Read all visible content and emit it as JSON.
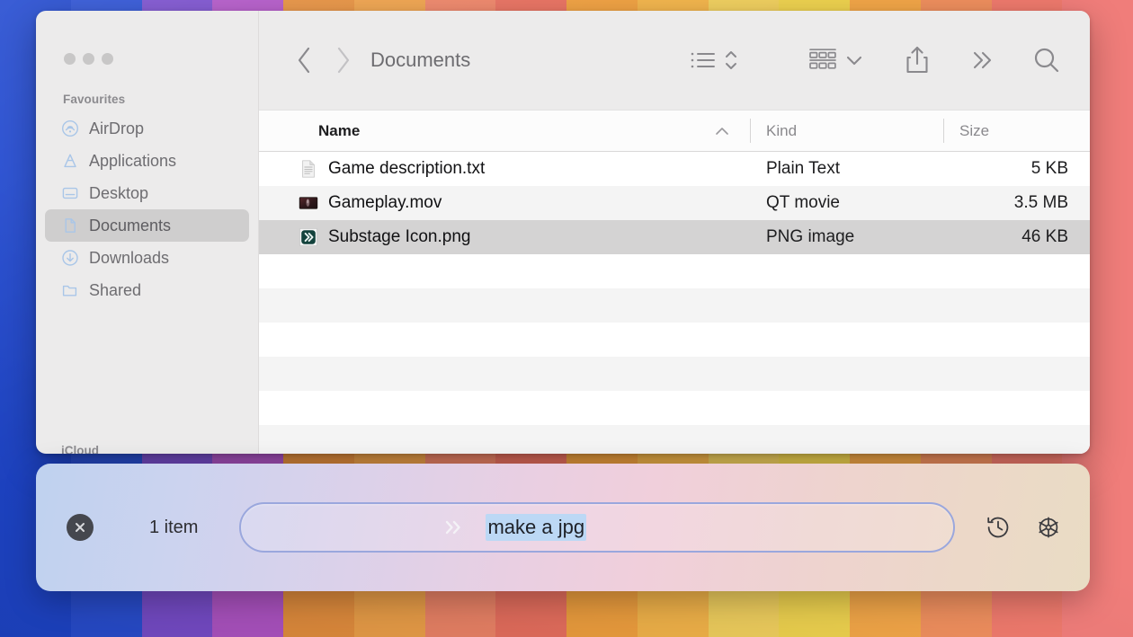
{
  "desktop": {
    "wallpaper_bands": [
      "#1f47cf",
      "#2a50d6",
      "#7b4fd0",
      "#b356c9",
      "#e8913f",
      "#f0a24a",
      "#ef8568",
      "#e9705f",
      "#f0a03f",
      "#f3b44a",
      "#f0cf5e",
      "#eed24f",
      "#f2a648",
      "#ef8f5e",
      "#ef7a6d",
      "#f07d7a"
    ]
  },
  "window": {
    "title": "Documents",
    "traffic_lights": [
      {
        "name": "close-button",
        "color": "#c8c7c7"
      },
      {
        "name": "minimize-button",
        "color": "#c8c7c7"
      },
      {
        "name": "zoom-button",
        "color": "#c8c7c7"
      }
    ]
  },
  "sidebar": {
    "sections": [
      {
        "header": "Favourites",
        "items": [
          {
            "label": "AirDrop",
            "icon": "airdrop-icon",
            "selected": false
          },
          {
            "label": "Applications",
            "icon": "applications-icon",
            "selected": false
          },
          {
            "label": "Desktop",
            "icon": "desktop-icon",
            "selected": false
          },
          {
            "label": "Documents",
            "icon": "document-icon",
            "selected": true
          },
          {
            "label": "Downloads",
            "icon": "downloads-icon",
            "selected": false
          },
          {
            "label": "Shared",
            "icon": "folder-icon",
            "selected": false
          }
        ]
      }
    ],
    "next_header": "iCloud"
  },
  "toolbar": {
    "back": {
      "icon": "chevron-left-icon",
      "enabled": true
    },
    "forward": {
      "icon": "chevron-right-icon",
      "enabled": false
    },
    "path_title": "Documents",
    "view_list": {
      "icon": "list-view-icon"
    },
    "view_sort": {
      "icon": "sort-updown-icon"
    },
    "group": {
      "icon": "group-grid-icon"
    },
    "group_chevron": {
      "icon": "chevron-down-icon"
    },
    "share": {
      "icon": "share-icon"
    },
    "more": {
      "icon": "double-chevron-right-icon"
    },
    "search": {
      "icon": "search-icon"
    }
  },
  "file_table": {
    "columns": [
      {
        "key": "name",
        "label": "Name",
        "sorted": true,
        "sort_caret": "chevron-up-icon"
      },
      {
        "key": "kind",
        "label": "Kind",
        "sorted": false
      },
      {
        "key": "size",
        "label": "Size",
        "sorted": false
      }
    ],
    "rows": [
      {
        "name": "Game description.txt",
        "kind": "Plain Text",
        "size": "5 KB",
        "icon": "text-file-icon",
        "selected": false
      },
      {
        "name": "Gameplay.mov",
        "kind": "QT movie",
        "size": "3.5 MB",
        "icon": "movie-file-icon",
        "selected": false
      },
      {
        "name": "Substage Icon.png",
        "kind": "PNG image",
        "size": "46 KB",
        "icon": "substage-png-icon",
        "selected": true
      }
    ],
    "empty_row_count": 9
  },
  "ai_bar": {
    "close": {
      "icon": "close-circle-icon"
    },
    "status": "1 item",
    "prompt_chevron": {
      "icon": "double-chevron-right-icon"
    },
    "input_value": "make a jpg",
    "input_placeholder": "",
    "history": {
      "icon": "history-clock-icon"
    },
    "settings": {
      "icon": "gear-icon"
    },
    "accent_border": "#9aa7dd",
    "selection_highlight": "#bcd8f5"
  }
}
